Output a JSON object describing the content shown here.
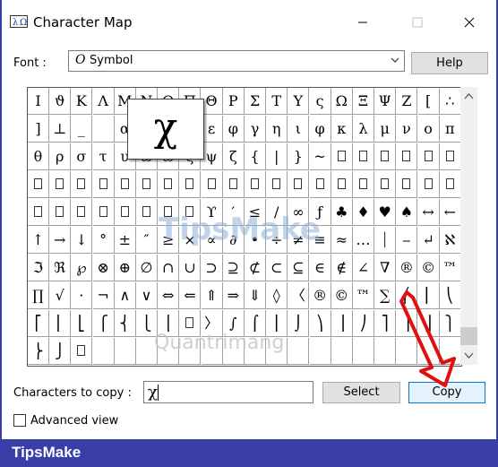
{
  "window": {
    "title": "Character Map",
    "controls": {
      "minimize": "minimize-icon",
      "maximize": "maximize-icon",
      "close": "close-icon"
    }
  },
  "font_row": {
    "label": "Font :",
    "selected_glyph": "O",
    "selected": "Symbol",
    "help_label": "Help"
  },
  "grid": {
    "rows": [
      [
        "I",
        "ϑ",
        "Κ",
        "Λ",
        "Μ",
        "Ν",
        "Ο",
        "Π",
        "Θ",
        "Ρ",
        "Σ",
        "Τ",
        "Υ",
        "ς",
        "Ω",
        "Ξ",
        "Ψ",
        "Ζ",
        "[",
        "∴"
      ],
      [
        "]",
        "⊥",
        "_",
        "",
        "α",
        "",
        "",
        "",
        "ε",
        "φ",
        "γ",
        "η",
        "ι",
        "φ",
        "κ",
        "λ",
        "μ",
        "ν",
        "ο",
        "π"
      ],
      [
        "θ",
        "ρ",
        "σ",
        "τ",
        "υ",
        "ϖ",
        "ω",
        "ξ",
        "ψ",
        "ζ",
        "{",
        "|",
        "}",
        "~",
        "□",
        "□",
        "□",
        "□",
        "□",
        "□"
      ],
      [
        "□",
        "□",
        "□",
        "□",
        "□",
        "□",
        "□",
        "□",
        "□",
        "□",
        "□",
        "□",
        "□",
        "□",
        "□",
        "□",
        "□",
        "□",
        "□",
        "□"
      ],
      [
        "□",
        "□",
        "□",
        "□",
        "□",
        "□",
        "□",
        "□",
        "ϒ",
        "′",
        "≤",
        "/",
        "∞",
        "ƒ",
        "♣",
        "♦",
        "♥",
        "♠",
        "↔",
        "←"
      ],
      [
        "↑",
        "→",
        "↓",
        "°",
        "±",
        "″",
        "≥",
        "×",
        "∝",
        "∂",
        "•",
        "÷",
        "≠",
        "≡",
        "≈",
        "…",
        "⏐",
        "⎯",
        "↵",
        "ℵ"
      ],
      [
        "ℑ",
        "ℜ",
        "℘",
        "⊗",
        "⊕",
        "∅",
        "∩",
        "∪",
        "⊃",
        "⊇",
        "⊄",
        "⊂",
        "⊆",
        "∈",
        "∉",
        "∠",
        "∇",
        "®",
        "©",
        "™"
      ],
      [
        "∏",
        "√",
        "⋅",
        "¬",
        "∧",
        "∨",
        "⇔",
        "⇐",
        "⇑",
        "⇒",
        "⇓",
        "◊",
        "〈",
        "®",
        "©",
        "™",
        "∑",
        "⎛",
        "⎜",
        "⎝"
      ],
      [
        "⎡",
        "⎢",
        "⎣",
        "⎧",
        "⎨",
        "⎩",
        "⎪",
        "□",
        "〉",
        "∫",
        "⌠",
        "⎮",
        "⌡",
        "⎞",
        "⎟",
        "⎠",
        "⎤",
        "⎥",
        "⎦",
        "⎫"
      ],
      [
        "⎬",
        "⎭",
        "□",
        "",
        "",
        "",
        "",
        "",
        "",
        "",
        "",
        "",
        "",
        "",
        "",
        "",
        "",
        "",
        "",
        ""
      ]
    ],
    "zoom_char": "χ"
  },
  "copy_row": {
    "label": "Characters to copy :",
    "value": "χ",
    "select_label": "Select",
    "copy_label": "Copy"
  },
  "advanced": {
    "label": "Advanced view",
    "checked": false
  },
  "watermarks": {
    "primary": "TipsMake",
    "secondary": "Quantrimang"
  },
  "footer": {
    "brand": "TipsMake"
  },
  "colors": {
    "footer_bg": "#3a3fa8",
    "arrow": "#e01010",
    "copy_button_border": "#0078d7"
  }
}
